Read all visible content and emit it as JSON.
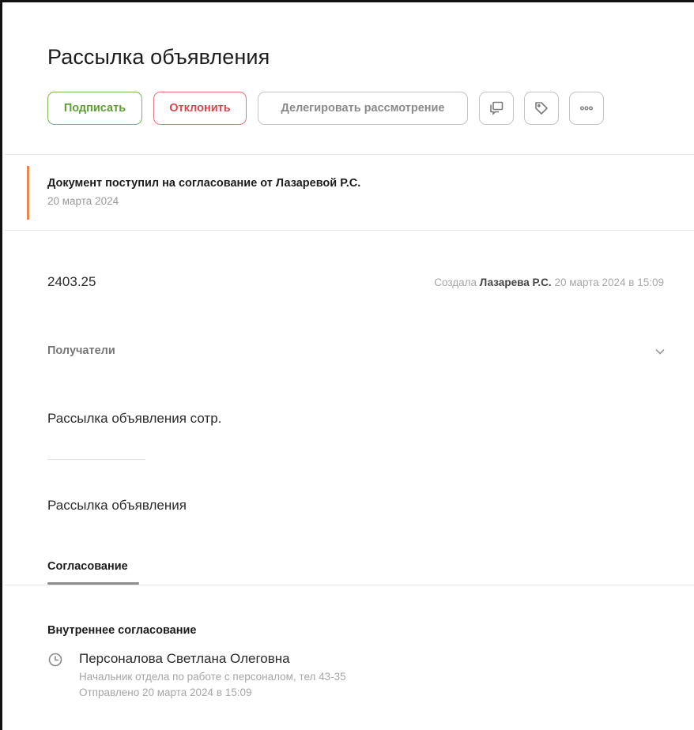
{
  "header": {
    "title": "Рассылка объявления"
  },
  "toolbar": {
    "sign_label": "Подписать",
    "reject_label": "Отклонить",
    "delegate_label": "Делегировать рассмотрение",
    "icons": [
      "comment-icon",
      "tag-icon",
      "more-icon"
    ]
  },
  "notice": {
    "title": "Документ поступил на согласование от Лазаревой Р.С.",
    "date": "20 марта 2024"
  },
  "document": {
    "number": "2403.25",
    "created_prefix": "Создала",
    "created_by": "Лазарева Р.С.",
    "created_at": "20 марта 2024 в 15:09",
    "recipients_label": "Получатели",
    "subject": "Рассылка объявления сотр.",
    "description": "Рассылка объявления"
  },
  "tabs": {
    "approval_label": "Согласование"
  },
  "approval": {
    "section_title": "Внутреннее согласование",
    "approver": {
      "name": "Персоналова Светлана Олеговна",
      "role": "Начальник отдела по работе с персоналом, тел 43-35",
      "sent": "Отправлено 20 марта 2024 в 15:09"
    }
  },
  "colors": {
    "sign": "#5d9e36",
    "reject": "#d9464c",
    "notice_accent": "#e8884a"
  }
}
